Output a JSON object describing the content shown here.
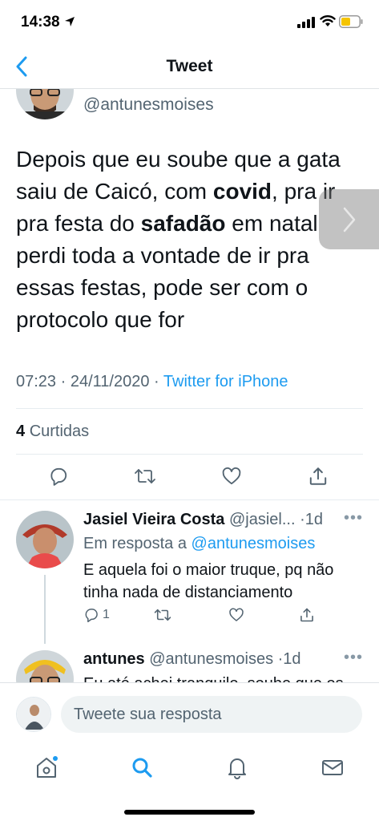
{
  "status_bar": {
    "time": "14:38"
  },
  "nav": {
    "title": "Tweet"
  },
  "tweet": {
    "handle": "@antunesmoises",
    "text_parts": [
      "Depois que eu soube que a gata saiu de Caicó, com ",
      "covid",
      ", pra ir pra festa do ",
      "safadão",
      " em natal perdi toda a vontade de ir pra essas festas, pode ser com o protocolo que for"
    ],
    "time": "07:23",
    "date": "24/11/2020",
    "separator": "·",
    "source": "Twitter for iPhone",
    "likes_count": "4",
    "likes_label": "Curtidas"
  },
  "replies": [
    {
      "name": "Jasiel Vieira  Costa",
      "handle": "@jasiel...",
      "age": "·1d",
      "more": "•••",
      "reply_to_label": "Em resposta a",
      "reply_to_mention": "@antunesmoises",
      "text": "E aquela foi o maior truque, pq não tinha nada de distanciamento",
      "reply_count": "1"
    },
    {
      "name": "antunes",
      "handle": "@antunesmoises",
      "age": "·1d",
      "more": "•••",
      "text": "Eu até achei tranquilo, soube que os"
    }
  ],
  "compose": {
    "placeholder": "Tweete sua resposta"
  },
  "icons": {
    "back": "chevron-left-icon",
    "reply": "comment-icon",
    "retweet": "retweet-icon",
    "like": "heart-icon",
    "share": "share-icon",
    "home": "home-icon",
    "search": "search-icon",
    "notifications": "bell-icon",
    "messages": "mail-icon",
    "next": "chevron-right-icon"
  },
  "colors": {
    "accent": "#1d9bf0",
    "text": "#0f1419",
    "muted": "#536471",
    "battery": "#f5c400"
  }
}
